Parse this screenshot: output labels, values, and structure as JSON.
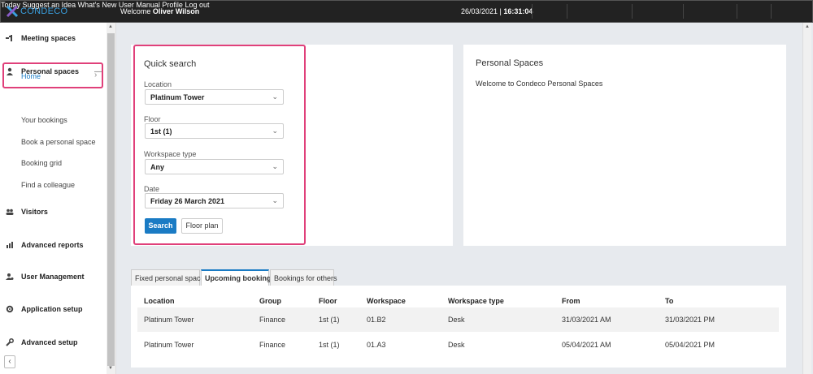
{
  "header": {
    "logo_text": "CONDECO",
    "welcome_prefix": "Welcome",
    "user_name": "Oliver Wilson",
    "date": "26/03/2021",
    "time": "16:31:04",
    "nav": [
      "Today",
      "Suggest an Idea",
      "What's New",
      "User Manual",
      "Profile",
      "Log out"
    ]
  },
  "sidebar": {
    "meeting_spaces": "Meeting spaces",
    "personal_spaces": "Personal spaces",
    "collapse_symbol": "—",
    "home": "Home",
    "your_bookings": "Your bookings",
    "book_personal_space": "Book a personal space",
    "booking_grid": "Booking grid",
    "find_colleague": "Find a colleague",
    "visitors": "Visitors",
    "advanced_reports": "Advanced reports",
    "user_management": "User Management",
    "application_setup": "Application setup",
    "advanced_setup": "Advanced setup"
  },
  "quick_search": {
    "title": "Quick search",
    "location_label": "Location",
    "location_value": "Platinum Tower",
    "floor_label": "Floor",
    "floor_value": "1st (1)",
    "workspace_type_label": "Workspace type",
    "workspace_type_value": "Any",
    "date_label": "Date",
    "date_value": "Friday 26 March 2021",
    "search_button": "Search",
    "floor_plan_button": "Floor plan"
  },
  "personal_spaces": {
    "title": "Personal Spaces",
    "welcome_text": "Welcome to Condeco Personal Spaces"
  },
  "tabs": [
    "Fixed personal space",
    "Upcoming bookings",
    "Bookings for others"
  ],
  "table": {
    "headers": [
      "Location",
      "Group",
      "Floor",
      "Workspace",
      "Workspace type",
      "From",
      "To"
    ],
    "rows": [
      [
        "Platinum Tower",
        "Finance",
        "1st (1)",
        "01.B2",
        "Desk",
        "31/03/2021 AM",
        "31/03/2021 PM"
      ],
      [
        "Platinum Tower",
        "Finance",
        "1st (1)",
        "01.A3",
        "Desk",
        "05/04/2021 AM",
        "05/04/2021 PM"
      ]
    ]
  },
  "colors": {
    "accent": "#1a7bc4",
    "highlight": "#e0407a",
    "topbar": "#222222"
  }
}
